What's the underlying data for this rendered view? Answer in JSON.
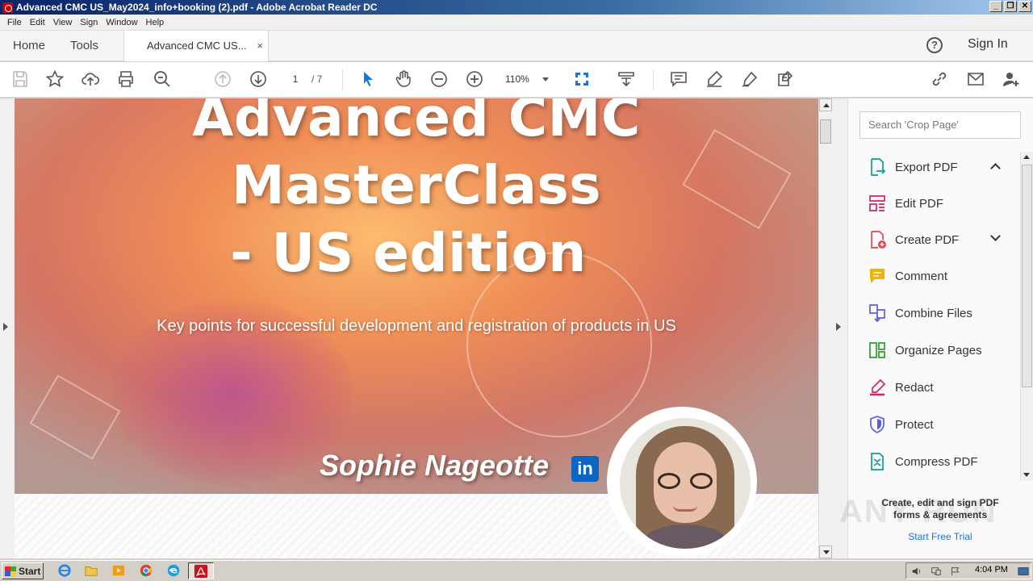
{
  "window": {
    "title": "Advanced CMC US_May2024_info+booking (2).pdf - Adobe Acrobat Reader DC",
    "controls": [
      "_",
      "❐",
      "✕"
    ]
  },
  "menu": [
    "File",
    "Edit",
    "View",
    "Sign",
    "Window",
    "Help"
  ],
  "tabs": {
    "home": "Home",
    "tools": "Tools",
    "document": "Advanced CMC US...",
    "close": "×"
  },
  "header": {
    "help": "?",
    "sign_in": "Sign In"
  },
  "toolbar": {
    "page_current": "1",
    "page_total": "/ 7",
    "zoom": "110%"
  },
  "document": {
    "title_lines": [
      "Advanced CMC",
      "MasterClass",
      "- US edition"
    ],
    "subtitle": "Key points for successful development and registration of products in US",
    "presenter": "Sophie Nageotte",
    "linkedin": "in"
  },
  "right_pane": {
    "search_placeholder": "Search 'Crop Page'",
    "tools": [
      {
        "label": "Export PDF",
        "icon": "export-pdf-icon",
        "color": "#0f9d8f"
      },
      {
        "label": "Edit PDF",
        "icon": "edit-pdf-icon",
        "color": "#d0246b"
      },
      {
        "label": "Create PDF",
        "icon": "create-pdf-icon",
        "color": "#e34850"
      },
      {
        "label": "Comment",
        "icon": "comment-icon",
        "color": "#f0b400"
      },
      {
        "label": "Combine Files",
        "icon": "combine-files-icon",
        "color": "#5c5ce0"
      },
      {
        "label": "Organize Pages",
        "icon": "organize-pages-icon",
        "color": "#2d9d2d"
      },
      {
        "label": "Redact",
        "icon": "redact-icon",
        "color": "#d0246b"
      },
      {
        "label": "Protect",
        "icon": "protect-icon",
        "color": "#5c5ce0"
      },
      {
        "label": "Compress PDF",
        "icon": "compress-pdf-icon",
        "color": "#0f9d8f"
      }
    ],
    "promo_line1": "Create, edit and sign PDF",
    "promo_line2": "forms & agreements",
    "trial": "Start Free Trial",
    "watermark": "ANY RUN"
  },
  "taskbar": {
    "start": "Start",
    "clock": "4:04 PM"
  }
}
